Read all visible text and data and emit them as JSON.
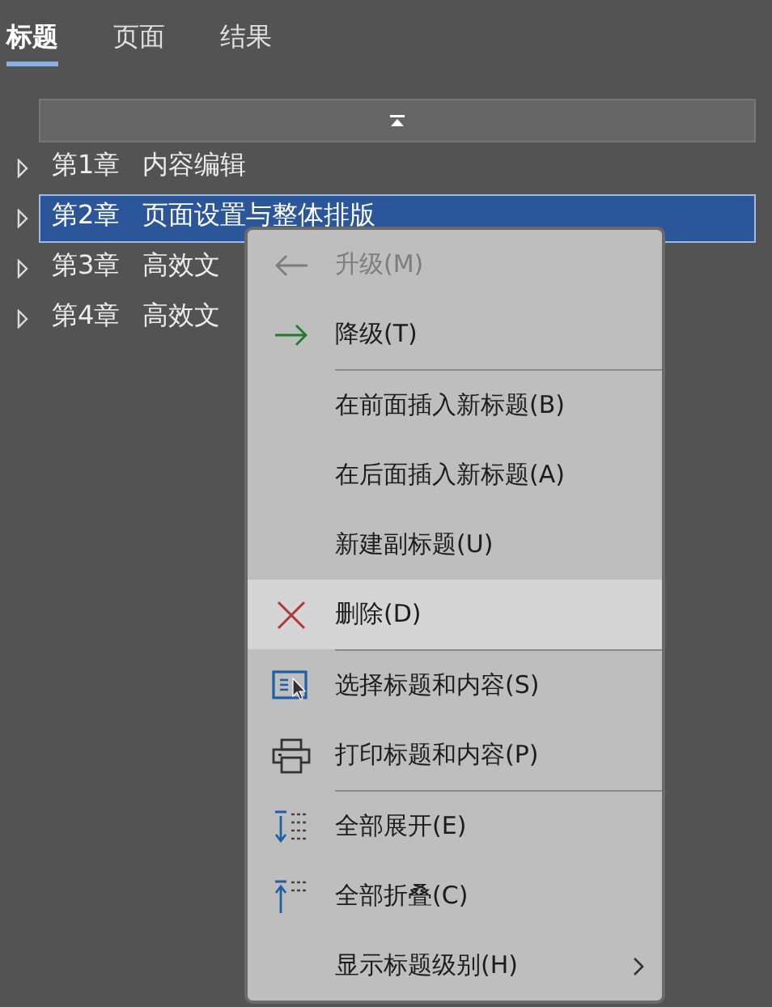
{
  "tabs": [
    {
      "label": "标题",
      "selected": true
    },
    {
      "label": "页面",
      "selected": false
    },
    {
      "label": "结果",
      "selected": false
    }
  ],
  "tree": {
    "items": [
      {
        "number": "第1章",
        "title": "内容编辑",
        "selected": false,
        "expanded": false
      },
      {
        "number": "第2章",
        "title": "页面设置与整体排版",
        "selected": true,
        "expanded": false
      },
      {
        "number": "第3章",
        "title": "高效文",
        "selected": false,
        "expanded": false
      },
      {
        "number": "第4章",
        "title": "高效文",
        "selected": false,
        "expanded": false
      }
    ]
  },
  "context_menu": {
    "items": [
      {
        "kind": "promote",
        "label": "升级(M)",
        "disabled": true,
        "selected": false
      },
      {
        "kind": "demote",
        "label": "降级(T)",
        "disabled": false,
        "selected": false
      },
      {
        "kind": "separator"
      },
      {
        "kind": "plain",
        "label": "在前面插入新标题(B)",
        "disabled": false,
        "selected": false
      },
      {
        "kind": "plain",
        "label": "在后面插入新标题(A)",
        "disabled": false,
        "selected": false
      },
      {
        "kind": "plain",
        "label": "新建副标题(U)",
        "disabled": false,
        "selected": false
      },
      {
        "kind": "delete",
        "label": "删除(D)",
        "disabled": false,
        "selected": true
      },
      {
        "kind": "separator"
      },
      {
        "kind": "select",
        "label": "选择标题和内容(S)",
        "disabled": false,
        "selected": false
      },
      {
        "kind": "print",
        "label": "打印标题和内容(P)",
        "disabled": false,
        "selected": false
      },
      {
        "kind": "separator"
      },
      {
        "kind": "expand",
        "label": "全部展开(E)",
        "disabled": false,
        "selected": false
      },
      {
        "kind": "collapse",
        "label": "全部折叠(C)",
        "disabled": false,
        "selected": false
      },
      {
        "kind": "submenu",
        "label": "显示标题级别(H)",
        "disabled": false,
        "selected": false
      }
    ]
  }
}
